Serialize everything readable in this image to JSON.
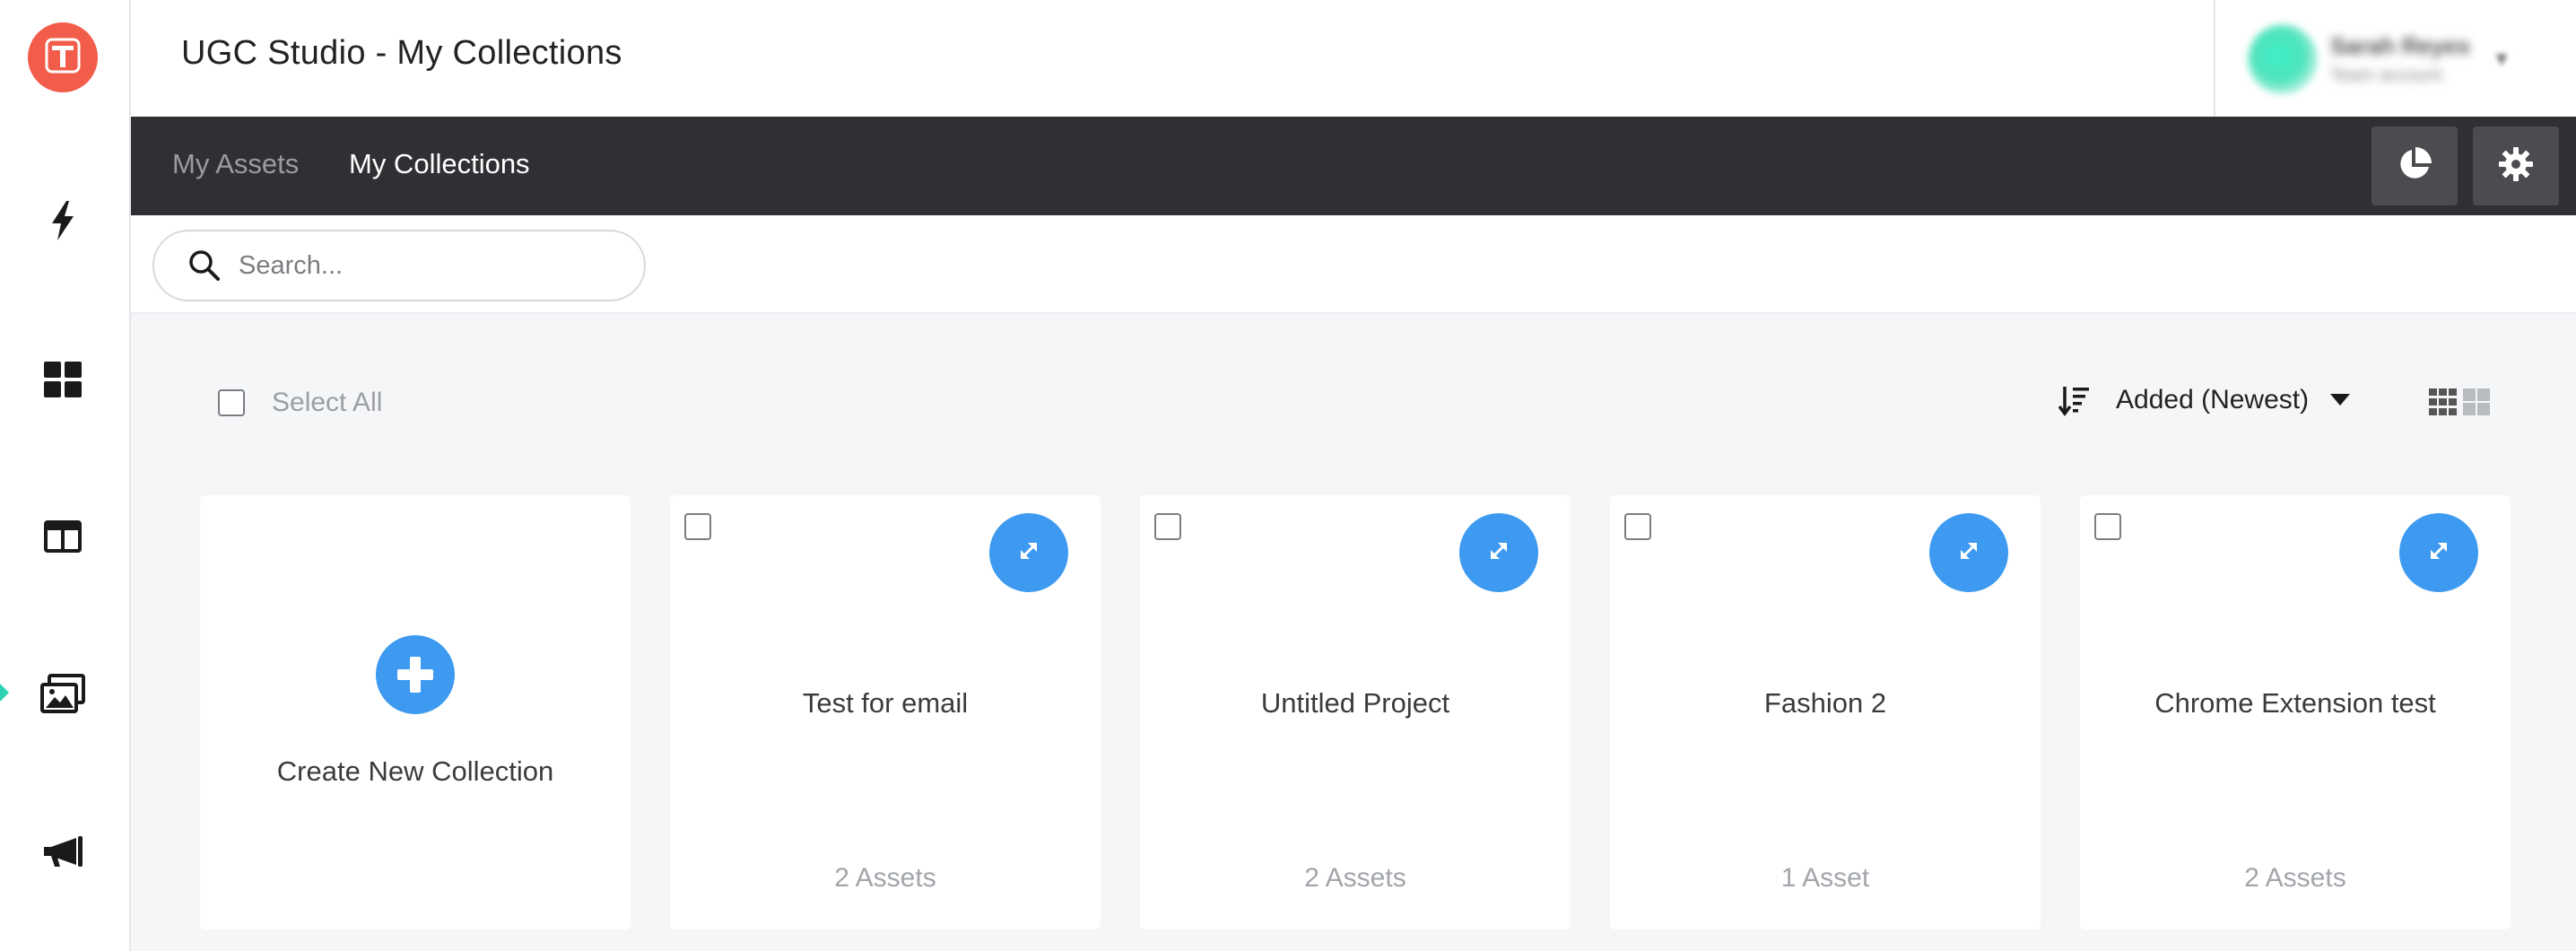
{
  "app": {
    "title": "UGC Studio - My Collections",
    "logo_letter": "T"
  },
  "user": {
    "name": "Sarah Reyes",
    "subtitle": "Team account"
  },
  "sidebar": {
    "items": [
      {
        "icon": "lightning-icon"
      },
      {
        "icon": "grid-icon"
      },
      {
        "icon": "layout-icon"
      },
      {
        "icon": "image-gallery-icon",
        "active": true
      },
      {
        "icon": "megaphone-icon"
      }
    ]
  },
  "tabs": [
    {
      "label": "My Assets",
      "active": false
    },
    {
      "label": "My Collections",
      "active": true
    }
  ],
  "search": {
    "placeholder": "Search...",
    "value": ""
  },
  "toolbar": {
    "select_all_label": "Select All",
    "sort_label": "Added (Newest)"
  },
  "create_card": {
    "label": "Create New Collection"
  },
  "collections": [
    {
      "title": "Test for email",
      "count": "2 Assets"
    },
    {
      "title": "Untitled Project",
      "count": "2 Assets"
    },
    {
      "title": "Fashion 2",
      "count": "1 Asset"
    },
    {
      "title": "Chrome Extension test",
      "count": "2 Assets"
    }
  ],
  "colors": {
    "accent": "#3d9af0",
    "logo": "#f25c4a",
    "tabbar": "#2f3033",
    "active_marker": "#2bd3b4"
  }
}
